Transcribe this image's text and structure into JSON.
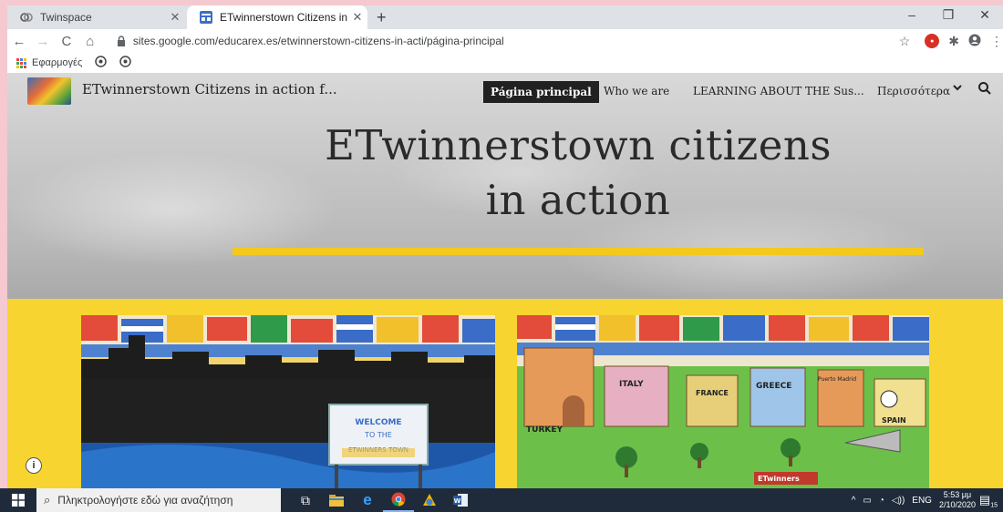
{
  "browser": {
    "tabs": [
      {
        "title": "Twinspace",
        "active": false,
        "favicon": "twinspace-icon"
      },
      {
        "title": "ETwinnerstown Citizens in action",
        "active": true,
        "favicon": "google-sites-icon"
      }
    ],
    "address": "sites.google.com/educarex.es/etwinnerstown-citizens-in-acti/página-principal",
    "bookmarks": {
      "apps_label": "Εφαρμογές"
    }
  },
  "site": {
    "title": "ETwinnerstown Citizens in action f...",
    "nav": {
      "current": "Página principal",
      "links": [
        "Who we are",
        "LEARNING ABOUT THE Sus..."
      ],
      "more": "Περισσότερα"
    },
    "hero": {
      "title_line1": "ETwinnerstown citizens",
      "title_line2": "in action"
    },
    "colors": {
      "accent": "#f2c91c",
      "band": "#f7d42f",
      "nav_active_bg": "#212121"
    },
    "images": [
      {
        "name": "drawing-welcome-etwinnerstown",
        "labels": [
          "WELCOME",
          "TO THE",
          "ETWINNERS TOWN"
        ]
      },
      {
        "name": "drawing-town-countries",
        "labels": [
          "ITALY",
          "FRANCE",
          "GREECE",
          "TURKEY",
          "SPAIN",
          "Puerto Madrid",
          "ETwinners"
        ]
      }
    ]
  },
  "taskbar": {
    "search_placeholder": "Πληκτρολογήστε εδώ για αναζήτηση",
    "lang": "ENG",
    "time": "5:53 μμ",
    "date": "2/10/2020",
    "notification_count": "15"
  }
}
